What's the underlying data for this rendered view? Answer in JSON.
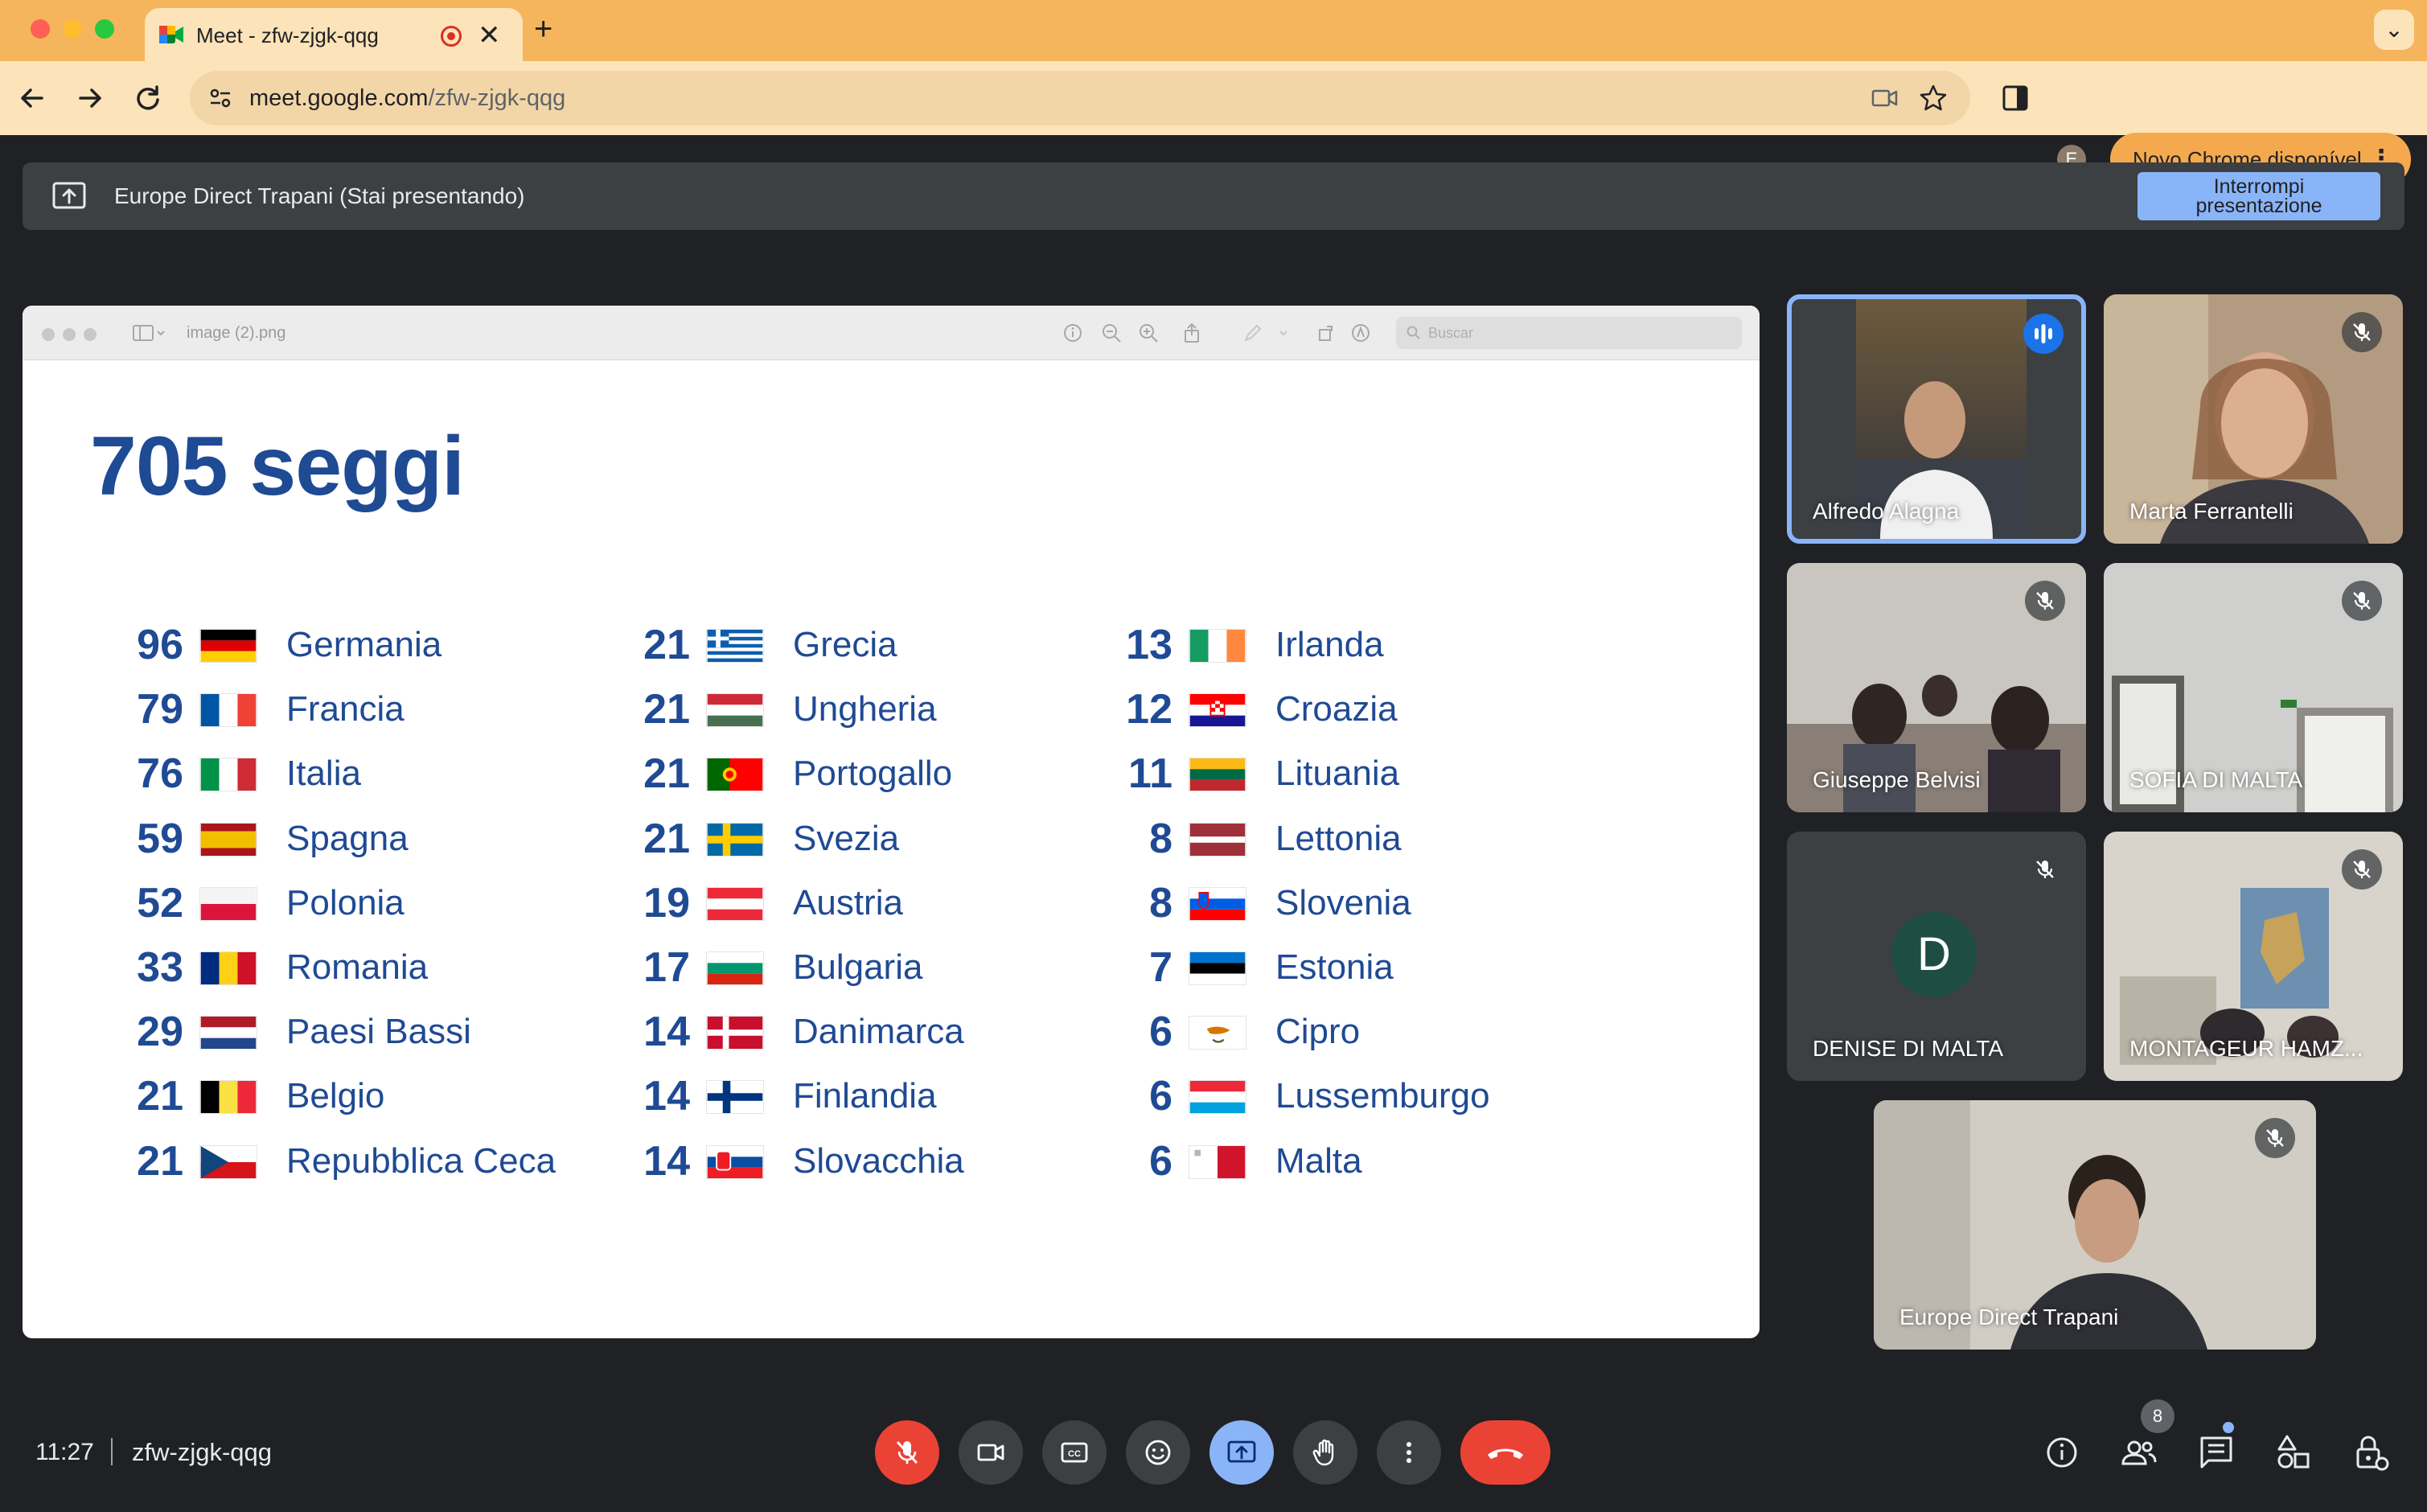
{
  "browser": {
    "tab_title": "Meet - zfw-zjgk-qqg",
    "tab_close": "✕",
    "new_tab": "+",
    "url_host": "meet.google.com",
    "url_path": "/zfw-zjgk-qqg",
    "profile_initial": "E",
    "update_label": "Novo Chrome disponível",
    "update_menu": "⋮",
    "tab_menu": "⌄"
  },
  "presenting": {
    "text": "Europe Direct Trapani (Stai presentando)",
    "stop_line1": "Interrompi",
    "stop_line2": "presentazione"
  },
  "viewer": {
    "file_name": "image (2).png",
    "search_placeholder": "Buscar"
  },
  "slide": {
    "title": "705 seggi",
    "columns": [
      [
        {
          "seats": "96",
          "name": "Germania",
          "flag": "germany"
        },
        {
          "seats": "79",
          "name": "Francia",
          "flag": "france"
        },
        {
          "seats": "76",
          "name": "Italia",
          "flag": "italy"
        },
        {
          "seats": "59",
          "name": "Spagna",
          "flag": "spain"
        },
        {
          "seats": "52",
          "name": "Polonia",
          "flag": "poland"
        },
        {
          "seats": "33",
          "name": "Romania",
          "flag": "romania"
        },
        {
          "seats": "29",
          "name": "Paesi Bassi",
          "flag": "netherlands"
        },
        {
          "seats": "21",
          "name": "Belgio",
          "flag": "belgium"
        },
        {
          "seats": "21",
          "name": "Repubblica Ceca",
          "flag": "czechia"
        }
      ],
      [
        {
          "seats": "21",
          "name": "Grecia",
          "flag": "greece"
        },
        {
          "seats": "21",
          "name": "Ungheria",
          "flag": "hungary"
        },
        {
          "seats": "21",
          "name": "Portogallo",
          "flag": "portugal"
        },
        {
          "seats": "21",
          "name": "Svezia",
          "flag": "sweden"
        },
        {
          "seats": "19",
          "name": "Austria",
          "flag": "austria"
        },
        {
          "seats": "17",
          "name": "Bulgaria",
          "flag": "bulgaria"
        },
        {
          "seats": "14",
          "name": "Danimarca",
          "flag": "denmark"
        },
        {
          "seats": "14",
          "name": "Finlandia",
          "flag": "finland"
        },
        {
          "seats": "14",
          "name": "Slovacchia",
          "flag": "slovakia"
        }
      ],
      [
        {
          "seats": "13",
          "name": "Irlanda",
          "flag": "ireland"
        },
        {
          "seats": "12",
          "name": "Croazia",
          "flag": "croatia"
        },
        {
          "seats": "11",
          "name": "Lituania",
          "flag": "lithuania"
        },
        {
          "seats": "8",
          "name": "Lettonia",
          "flag": "latvia"
        },
        {
          "seats": "8",
          "name": "Slovenia",
          "flag": "slovenia"
        },
        {
          "seats": "7",
          "name": "Estonia",
          "flag": "estonia"
        },
        {
          "seats": "6",
          "name": "Cipro",
          "flag": "cyprus"
        },
        {
          "seats": "6",
          "name": "Lussemburgo",
          "flag": "luxembourg"
        },
        {
          "seats": "6",
          "name": "Malta",
          "flag": "malta"
        }
      ]
    ]
  },
  "participants": [
    {
      "name": "Alfredo Alagna",
      "state": "speaking"
    },
    {
      "name": "Marta Ferrantelli",
      "state": "muted"
    },
    {
      "name": "Giuseppe Belvisi",
      "state": "muted"
    },
    {
      "name": "SOFIA DI MALTA",
      "state": "muted"
    },
    {
      "name": "DENISE DI MALTA",
      "state": "muted",
      "avatar": "D"
    },
    {
      "name": "MONTAGEUR HAMZ...",
      "state": "muted"
    },
    {
      "name": "Europe Direct Trapani",
      "state": "muted"
    }
  ],
  "footer": {
    "time": "11:27",
    "meeting_code": "zfw-zjgk-qqg",
    "people_count": "8"
  },
  "colors": {
    "accent": "#8ab4f8",
    "danger": "#ea4335",
    "slide_text": "#1f4a94",
    "chrome_tab_bar": "#f5b55c"
  }
}
